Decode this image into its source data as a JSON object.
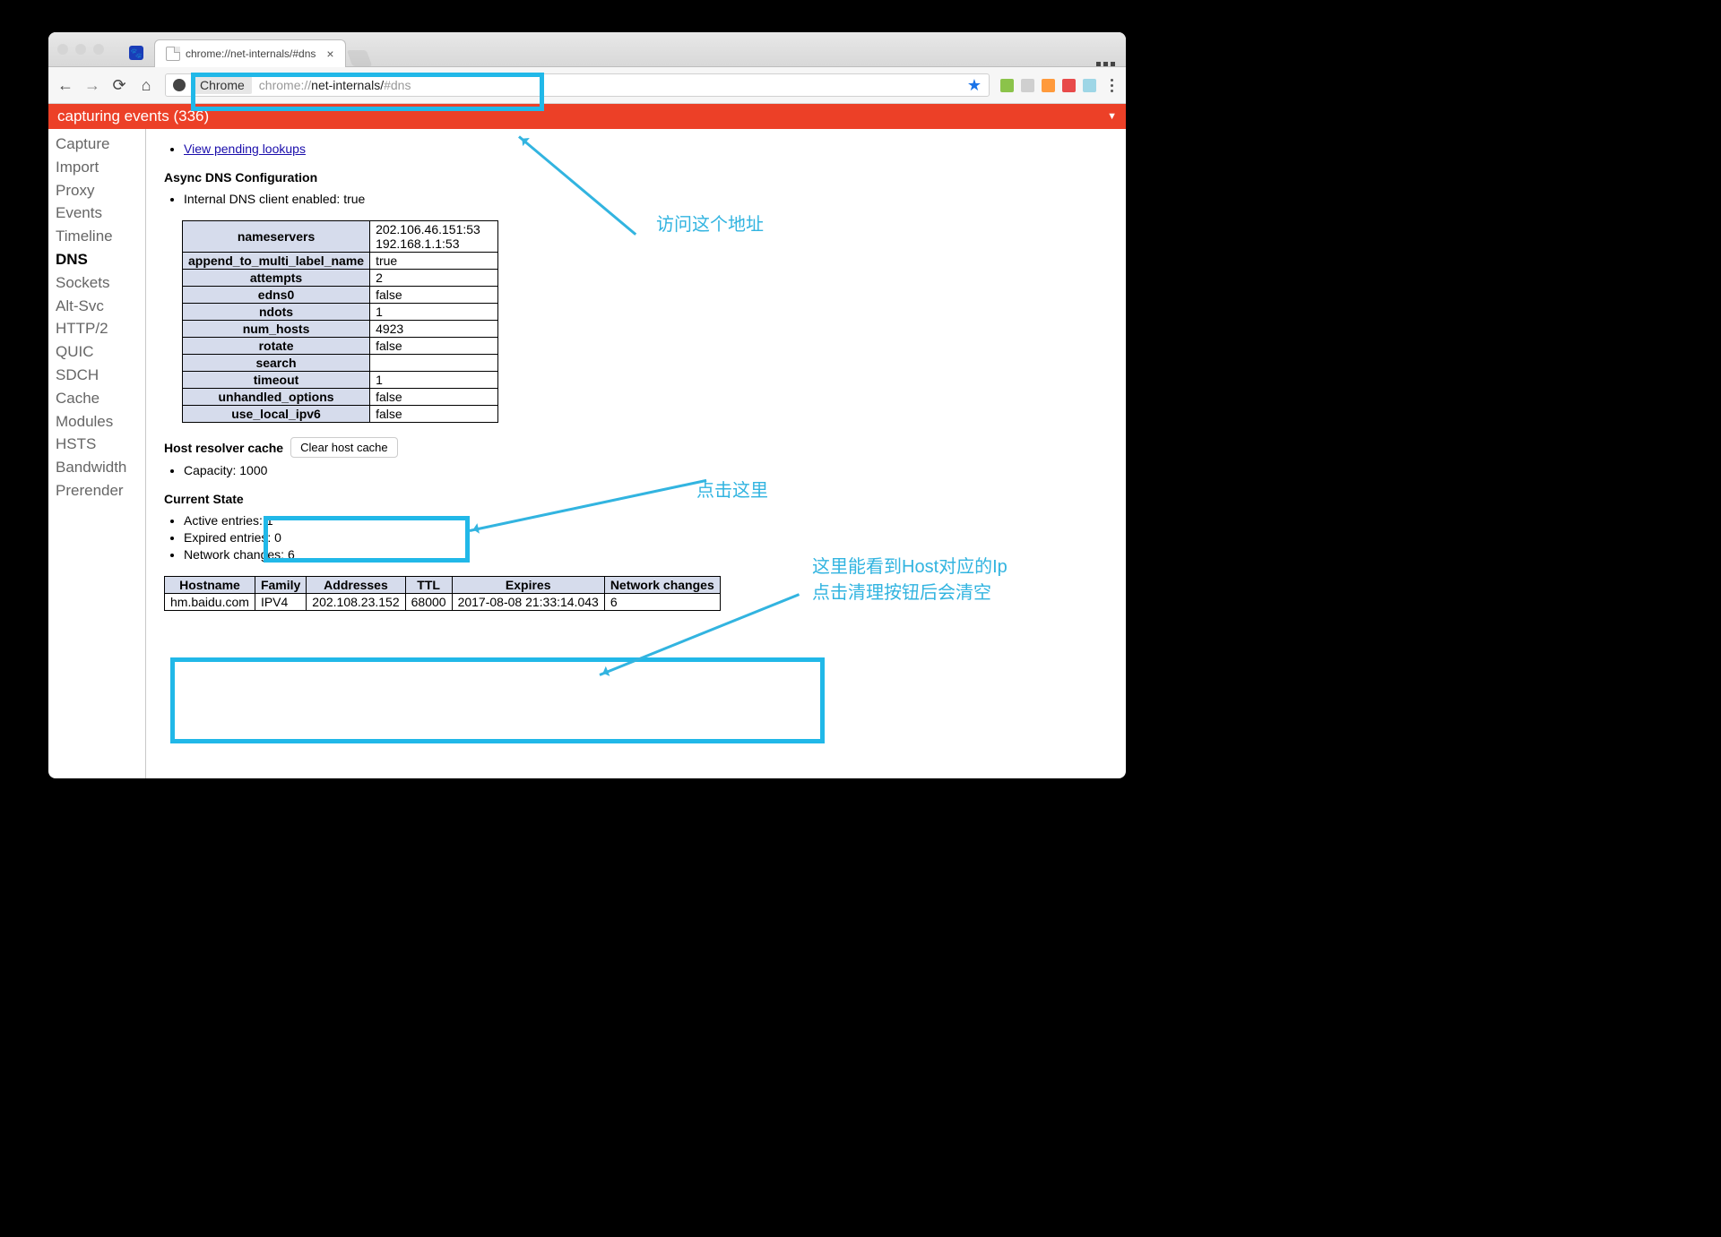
{
  "tab_title": "chrome://net-internals/#dns",
  "omnibox": {
    "keyword_chip": "Chrome",
    "url_lite1": "chrome://",
    "url_strong": "net-internals/",
    "url_lite2": "#dns"
  },
  "banner_text": "capturing events (336)",
  "sidebar_items": [
    "Capture",
    "Import",
    "Proxy",
    "Events",
    "Timeline",
    "DNS",
    "Sockets",
    "Alt-Svc",
    "HTTP/2",
    "QUIC",
    "SDCH",
    "Cache",
    "Modules",
    "HSTS",
    "Bandwidth",
    "Prerender"
  ],
  "active_sidebar": "DNS",
  "links": {
    "pending": "View pending lookups"
  },
  "async_title": "Async DNS Configuration",
  "async_line": "Internal DNS client enabled: true",
  "cfg": {
    "rows": [
      {
        "k": "nameservers",
        "v": "202.106.46.151:53\n192.168.1.1:53"
      },
      {
        "k": "append_to_multi_label_name",
        "v": "true"
      },
      {
        "k": "attempts",
        "v": "2"
      },
      {
        "k": "edns0",
        "v": "false"
      },
      {
        "k": "ndots",
        "v": "1"
      },
      {
        "k": "num_hosts",
        "v": "4923"
      },
      {
        "k": "rotate",
        "v": "false"
      },
      {
        "k": "search",
        "v": ""
      },
      {
        "k": "timeout",
        "v": "1"
      },
      {
        "k": "unhandled_options",
        "v": "false"
      },
      {
        "k": "use_local_ipv6",
        "v": "false"
      }
    ]
  },
  "resolver_label": "Host resolver cache",
  "clear_btn": "Clear host cache",
  "capacity_line": "Capacity: 1000",
  "current_state_title": "Current State",
  "state_lines": [
    "Active entries: 1",
    "Expired entries: 0",
    "Network changes: 6"
  ],
  "entries": {
    "headers": [
      "Hostname",
      "Family",
      "Addresses",
      "TTL",
      "Expires",
      "Network changes"
    ],
    "row": [
      "hm.baidu.com",
      "IPV4",
      "202.108.23.152",
      "68000",
      "2017-08-08 21:33:14.043",
      "6"
    ]
  },
  "annotations": {
    "a1": "访问这个地址",
    "a2": "点击这里",
    "a3_1": "这里能看到Host对应的Ip",
    "a3_2": "点击清理按钮后会清空"
  }
}
